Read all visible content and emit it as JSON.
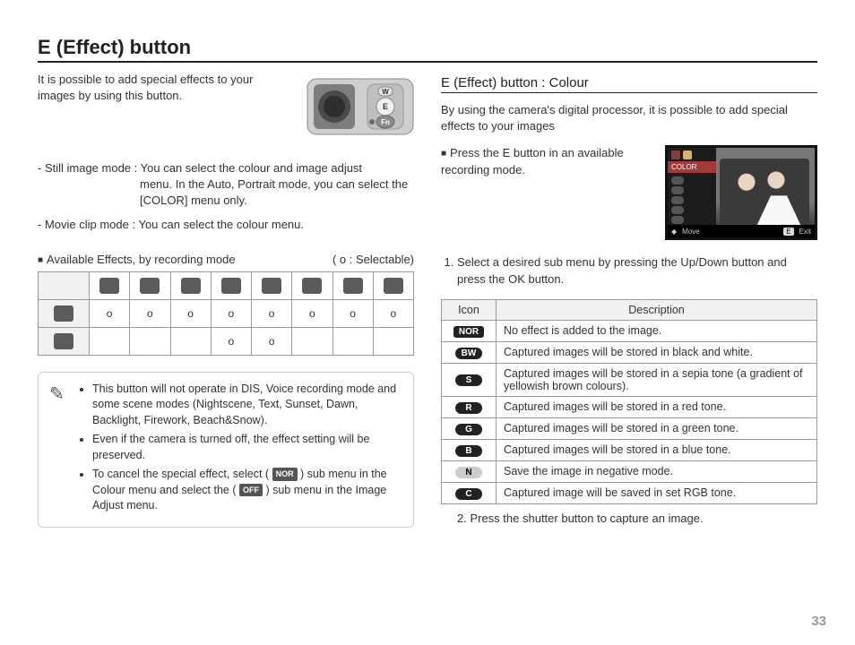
{
  "title": "E (Effect) button",
  "intro": "It is possible to add special effects to your images by using this button.",
  "still_label": "- Still image mode : ",
  "still_detail_1": "You can select the colour and image adjust",
  "still_detail_2": "menu. In the Auto, Portrait mode, you can select the [COLOR] menu only.",
  "movie_label": "- Movie clip mode : ",
  "movie_detail": "You can select the colour menu.",
  "avail_label": "Available Effects, by recording mode",
  "avail_legend": "( o : Selectable)",
  "effects_table": {
    "modes_count": 8,
    "rows": [
      {
        "cells": [
          "o",
          "o",
          "o",
          "o",
          "o",
          "o",
          "o",
          "o"
        ]
      },
      {
        "cells": [
          "",
          "",
          "",
          "o",
          "o",
          "",
          "",
          ""
        ]
      }
    ]
  },
  "notes": {
    "n1": "This button will not operate in DIS, Voice recording mode and some scene modes (Nightscene, Text, Sunset, Dawn, Backlight, Firework, Beach&Snow).",
    "n2": "Even if the camera is turned off, the effect setting will be preserved.",
    "n3_a": "To cancel the special effect, select ( ",
    "n3_badge1": "NOR",
    "n3_b": " ) sub menu in the Colour menu and select the ( ",
    "n3_badge2": "OFF",
    "n3_c": " ) sub menu in the Image Adjust menu."
  },
  "right": {
    "subtitle": "E (Effect) button : Colour",
    "subintro": "By using the camera's digital processor, it is possible to add special effects to your images",
    "press": "Press the E button in an available recording mode.",
    "lcd": {
      "color_label": "COLOR",
      "move": "Move",
      "exit_key": "E",
      "exit": "Exit"
    },
    "step1": "Select a desired sub menu by pressing the Up/Down button and press the OK button.",
    "desc_head_icon": "Icon",
    "desc_head_desc": "Description",
    "desc_rows": [
      {
        "icon": "NOR",
        "style": "rect",
        "text": "No effect is added to the image."
      },
      {
        "icon": "BW",
        "style": "pill",
        "text": "Captured images will be stored in black and white."
      },
      {
        "icon": "S",
        "style": "pill",
        "text": "Captured images will be stored in a sepia tone (a gradient of yellowish brown colours)."
      },
      {
        "icon": "R",
        "style": "pill",
        "text": "Captured images will be stored in a red tone."
      },
      {
        "icon": "G",
        "style": "pill",
        "text": "Captured images will be stored in a green tone."
      },
      {
        "icon": "B",
        "style": "pill",
        "text": "Captured images will be stored in a blue tone."
      },
      {
        "icon": "N",
        "style": "neg",
        "text": "Save the image in negative mode."
      },
      {
        "icon": "C",
        "style": "pill",
        "text": "Captured image will be saved in set RGB tone."
      }
    ],
    "step2": "2. Press the shutter button to capture an image."
  },
  "page_num": "33"
}
